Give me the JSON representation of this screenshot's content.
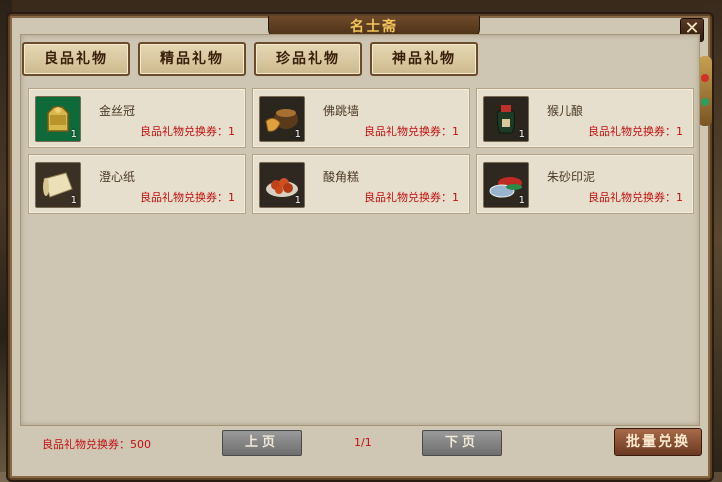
{
  "window": {
    "title": "名士斋",
    "close_label": "✕"
  },
  "tabs": [
    {
      "label": "良品礼物"
    },
    {
      "label": "精品礼物"
    },
    {
      "label": "珍品礼物"
    },
    {
      "label": "神品礼物"
    }
  ],
  "items": [
    {
      "name": "金丝冠",
      "cost": "良品礼物兑换券：1",
      "count": "1",
      "icon": "golden-crown-icon"
    },
    {
      "name": "佛跳墙",
      "cost": "良品礼物兑换券：1",
      "count": "1",
      "icon": "soup-pot-icon"
    },
    {
      "name": "猴儿酿",
      "cost": "良品礼物兑换券：1",
      "count": "1",
      "icon": "wine-jar-icon"
    },
    {
      "name": "澄心纸",
      "cost": "良品礼物兑换券：1",
      "count": "1",
      "icon": "paper-scroll-icon"
    },
    {
      "name": "酸角糕",
      "cost": "良品礼物兑换券：1",
      "count": "1",
      "icon": "cake-plate-icon"
    },
    {
      "name": "朱砂印泥",
      "cost": "良品礼物兑换券：1",
      "count": "1",
      "icon": "ink-pad-icon"
    }
  ],
  "footer": {
    "balance": "良品礼物兑换券：500",
    "prev_label": "上页",
    "page": "1/1",
    "next_label": "下页",
    "bulk_label": "批量兑换"
  }
}
